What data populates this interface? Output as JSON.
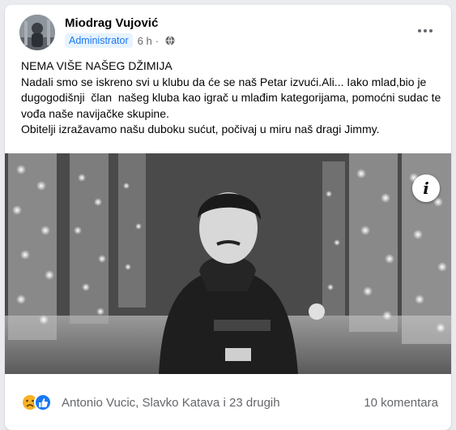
{
  "post": {
    "author": {
      "name": "Miodrag Vujović",
      "role_badge": "Administrator",
      "time": "6 h",
      "separator": "·",
      "audience_icon": "globe-icon"
    },
    "more_icon": "more-options-icon",
    "text_lines": [
      "NEMA VIŠE NAŠEG DŽIMIJA",
      "Nadali smo se iskreno svi u klubu da će se naš Petar izvući.Ali... Iako mlad,bio je dugogodišnji  član  našeg kluba kao igrač u mlađim kategorijama, pomoćni sudac te vođa naše navijačke skupine.",
      "Obitelji izražavamo našu duboku sućut, počivaj u miru naš dragi Jimmy."
    ],
    "photo": {
      "info_glyph": "i"
    },
    "reactions": {
      "icons": [
        "sad-reaction-icon",
        "like-reaction-icon"
      ],
      "names": "Antonio Vucic, Slavko Katava i 23 drugih",
      "comments": "10 komentara"
    }
  },
  "colors": {
    "accent": "#1877f2",
    "badge_bg": "#e7f3ff",
    "secondary_text": "#65676b",
    "sad_yellow": "#f7b125",
    "like_blue": "#1877f2"
  }
}
